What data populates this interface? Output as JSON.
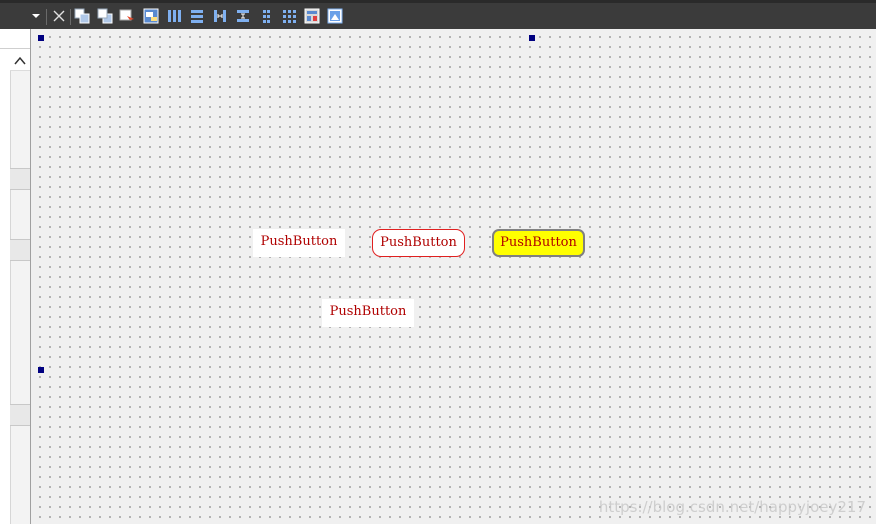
{
  "toolbar": {
    "icons": [
      "dropdown-arrow-icon",
      "close-icon",
      "send-to-back-icon",
      "bring-to-front-icon",
      "edit-tab-order-icon",
      "edit-buddies-icon",
      "layout-horizontal-icon",
      "layout-vertical-icon",
      "layout-horizontal-splitter-icon",
      "layout-vertical-splitter-icon",
      "layout-form-icon",
      "layout-grid-icon",
      "break-layout-icon",
      "adjust-size-icon"
    ]
  },
  "form": {
    "buttons": [
      {
        "label": "PushButton",
        "style": "flat-white"
      },
      {
        "label": "PushButton",
        "style": "rounded-red-border"
      },
      {
        "label": "PushButton",
        "style": "yellow-rounded"
      },
      {
        "label": "PushButton",
        "style": "flat-white"
      }
    ]
  },
  "watermark": "https://blog.csdn.net/happyjoey217",
  "colors": {
    "button_text": "#b00000",
    "yellow_fill": "#ffff00",
    "red_border": "#e02020",
    "handle": "#000080",
    "toolbar_bg": "#3b3b3b"
  }
}
